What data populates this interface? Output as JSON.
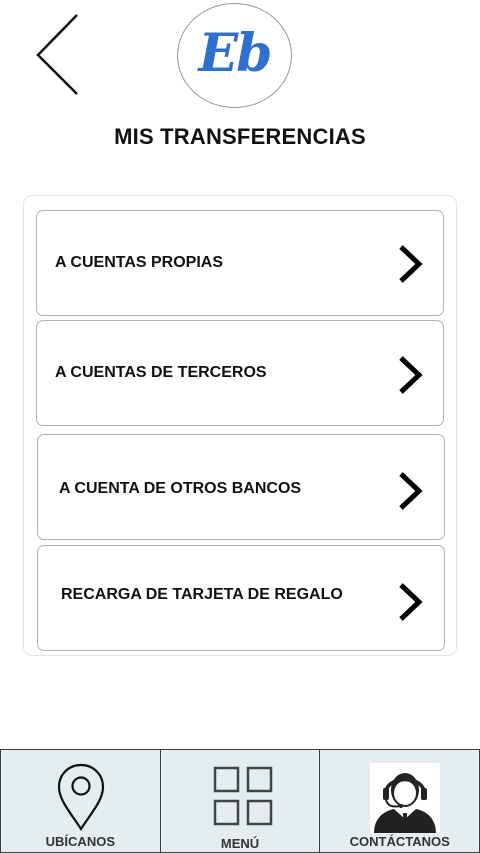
{
  "header": {
    "logo_text": "Eb",
    "title": "MIS TRANSFERENCIAS"
  },
  "options": [
    {
      "label": "A CUENTAS PROPIAS",
      "icon": "chevron-right-icon"
    },
    {
      "label": "A CUENTAS DE TERCEROS",
      "icon": "chevron-right-icon"
    },
    {
      "label": "A CUENTA DE OTROS BANCOS",
      "icon": "chevron-right-icon"
    },
    {
      "label": "RECARGA DE TARJETA DE REGALO",
      "icon": "chevron-right-icon"
    }
  ],
  "bottom_nav": [
    {
      "label": "UBÍCANOS",
      "icon": "location-pin-icon"
    },
    {
      "label": "MENÚ",
      "icon": "grid-menu-icon"
    },
    {
      "label": "CONTÁCTANOS",
      "icon": "support-agent-icon"
    }
  ],
  "colors": {
    "brand_blue": "#2f6fcf",
    "nav_background": "#e4edf0"
  }
}
